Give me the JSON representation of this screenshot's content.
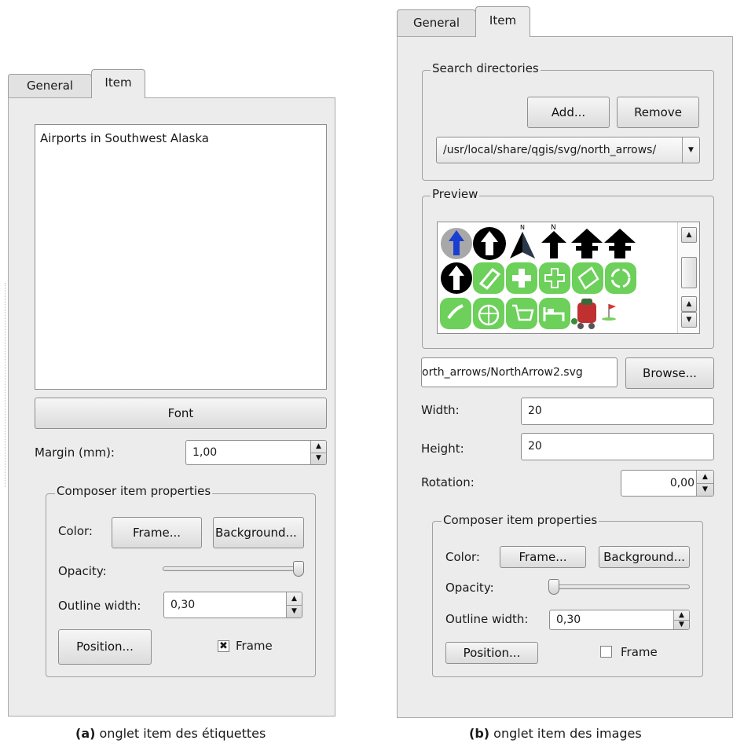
{
  "left": {
    "tabs": [
      "General",
      "Item"
    ],
    "label_text": "Airports in Southwest Alaska",
    "font_button": "Font",
    "margin_label": "Margin (mm):",
    "margin_value": "1,00",
    "composer_group": "Composer item properties",
    "color_label": "Color:",
    "frame_button": "Frame...",
    "background_button": "Background...",
    "opacity_label": "Opacity:",
    "opacity_level": 1.0,
    "outline_label": "Outline width:",
    "outline_value": "0,30",
    "position_button": "Position...",
    "frame_check_label": "Frame",
    "frame_checked": true,
    "caption_bold": "(a)",
    "caption_text": " onglet item des étiquettes"
  },
  "right": {
    "tabs": [
      "General",
      "Item"
    ],
    "search_group": "Search directories",
    "add_button": "Add...",
    "remove_button": "Remove",
    "directory_value": "/usr/local/share/qgis/svg/north_arrows/",
    "preview_group": "Preview",
    "file_value": "orth_arrows/NorthArrow2.svg",
    "browse_button": "Browse...",
    "width_label": "Width:",
    "width_value": "20",
    "height_label": "Height:",
    "height_value": "20",
    "rotation_label": "Rotation:",
    "rotation_value": "0,00",
    "composer_group": "Composer item properties",
    "color_label": "Color:",
    "frame_button": "Frame...",
    "background_button": "Background...",
    "opacity_label": "Opacity:",
    "opacity_level": 0.0,
    "outline_label": "Outline width:",
    "outline_value": "0,30",
    "position_button": "Position...",
    "frame_check_label": "Frame",
    "frame_checked": false,
    "caption_bold": "(b)",
    "caption_text": " onglet item des images"
  },
  "colors": {
    "panel": "#ececec",
    "green_icon": "#6cd05a",
    "blue_arrow": "#1a3fd0"
  }
}
